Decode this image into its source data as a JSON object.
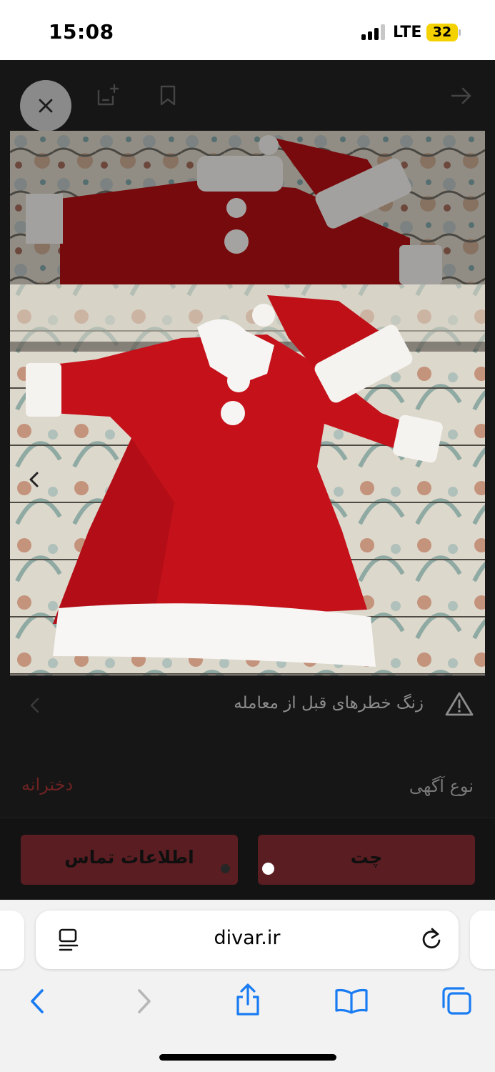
{
  "status_bar": {
    "time": "15:08",
    "network": "LTE",
    "battery": "32",
    "signal_bars_active": 3,
    "signal_bars_total": 4,
    "battery_color": "#f4d200"
  },
  "listing": {
    "top_bar_icons": [
      "close-icon",
      "add-note-icon",
      "bookmark-icon",
      "forward-arrow-icon"
    ],
    "photo_description_icon": "santa-costume-photo",
    "warning": {
      "text": "زنگ خطرهای قبل از معامله",
      "icon": "warning-triangle-icon",
      "chevron": "chevron-left-icon"
    },
    "ad_type": {
      "label": "نوع آگهی",
      "value": "دخترانه"
    },
    "actions": {
      "contact_label": "اطلاعات تماس",
      "chat_label": "چت"
    },
    "colors": {
      "accent_button": "#5a1d22",
      "accent_text": "#6e2222",
      "background": "#161616"
    }
  },
  "browser": {
    "url": "divar.ir",
    "icons": [
      "reader-icon",
      "reload-icon",
      "back-icon",
      "forward-icon",
      "share-icon",
      "bookmarks-icon",
      "tabs-icon"
    ],
    "accent": "#1a7cf2"
  }
}
